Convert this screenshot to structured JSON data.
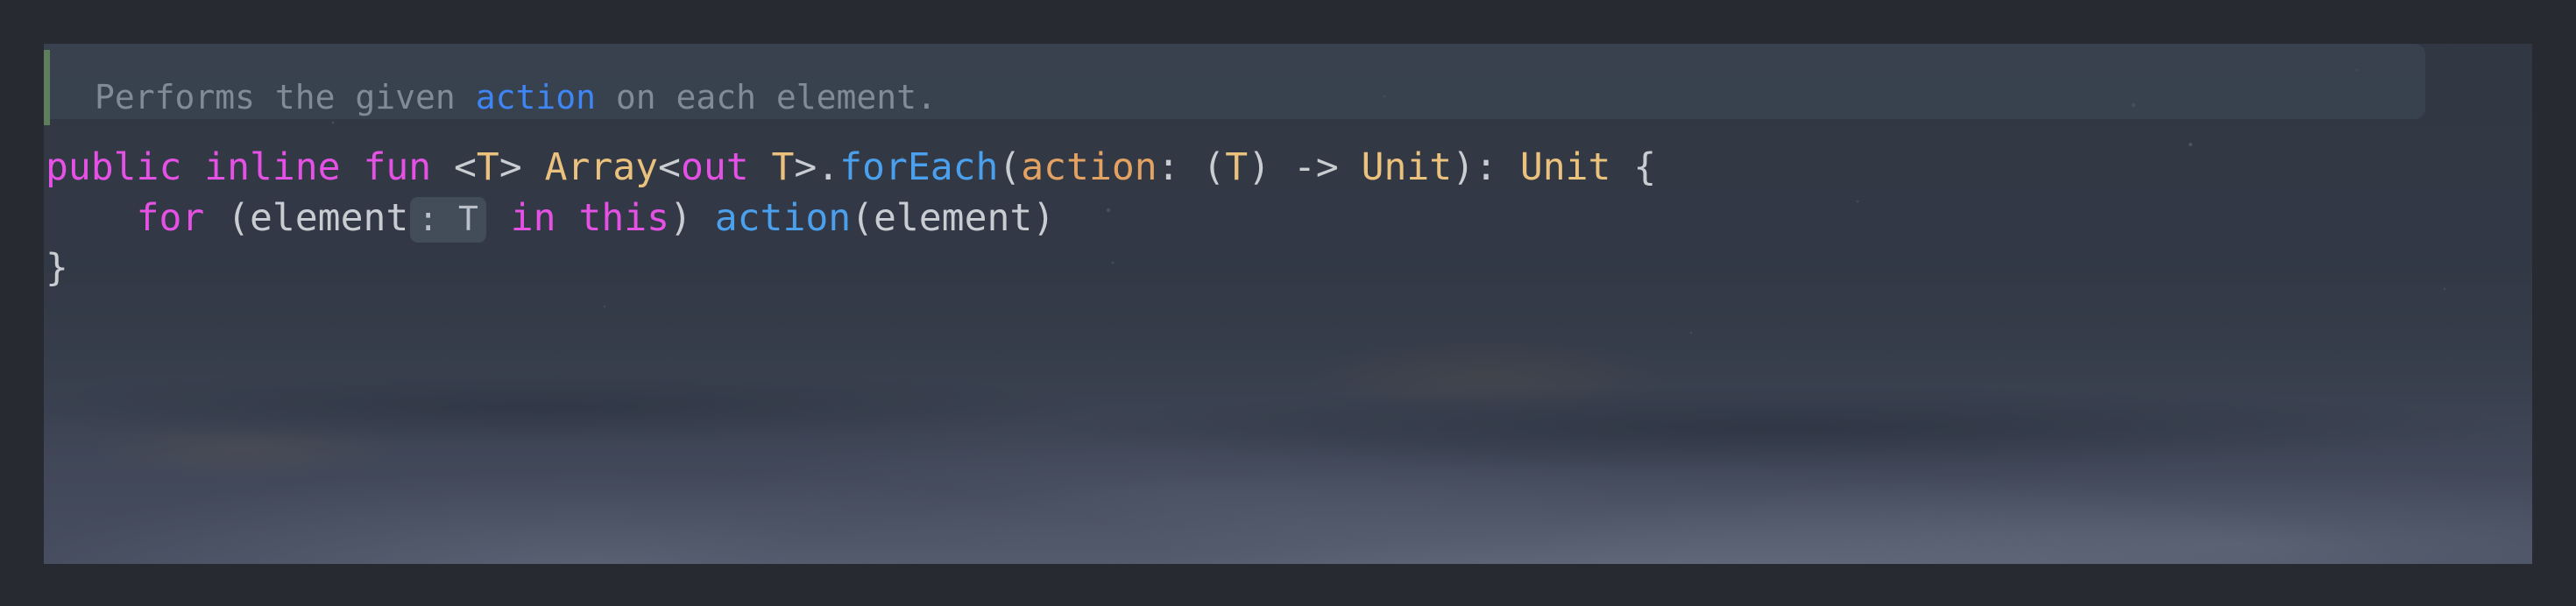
{
  "window": {
    "background_color": "#272A31",
    "editor_background_color": "#39404E"
  },
  "editor": {
    "language": "Kotlin",
    "theme_colors": {
      "doc_comment": "#808B98",
      "doc_link": "#3E86F5",
      "keyword": "#E451E4",
      "type": "#EBC17E",
      "plain": "#C9CDD2",
      "function": "#4BA0EE",
      "parameter": "#E3A262",
      "doc_accent_bar": "#5F7F5C",
      "inlay_hint_background": "#4E5866"
    },
    "doc_comment": {
      "text_before_link": "Performs the given ",
      "link_text": "action",
      "text_after_link": " on each element."
    },
    "signature_line": {
      "kw_public": "public",
      "space_1": " ",
      "kw_inline": "inline",
      "space_2": " ",
      "kw_fun": "fun",
      "space_3": " ",
      "generic_open": "<",
      "generic_t": "T",
      "generic_close": ">",
      "space_4": " ",
      "receiver_type": "Array",
      "angle_open": "<",
      "kw_out": "out",
      "space_5": " ",
      "variance_t": "T",
      "angle_close": ">",
      "dot": ".",
      "fn_name": "forEach",
      "paren_open": "(",
      "param_name": "action",
      "colon": ":",
      "space_6": " ",
      "lambda_paren_open": "(",
      "lambda_t": "T",
      "lambda_paren_close": ")",
      "arrow": " -> ",
      "lambda_return": "Unit",
      "paren_close": ")",
      "return_colon": ":",
      "space_7": " ",
      "return_type": "Unit",
      "space_8": " ",
      "brace_open": "{"
    },
    "for_line": {
      "indent": "    ",
      "kw_for": "for",
      "space_1": " ",
      "paren_open": "(",
      "loop_var": "element",
      "inlay_hint": ": T",
      "space_2": " ",
      "kw_in": "in",
      "space_3": " ",
      "kw_this": "this",
      "paren_close": ")",
      "space_4": " ",
      "call_name": "action",
      "call_paren_open": "(",
      "call_arg": "element",
      "call_paren_close": ")"
    },
    "closing_line": {
      "brace_close": "}"
    }
  }
}
